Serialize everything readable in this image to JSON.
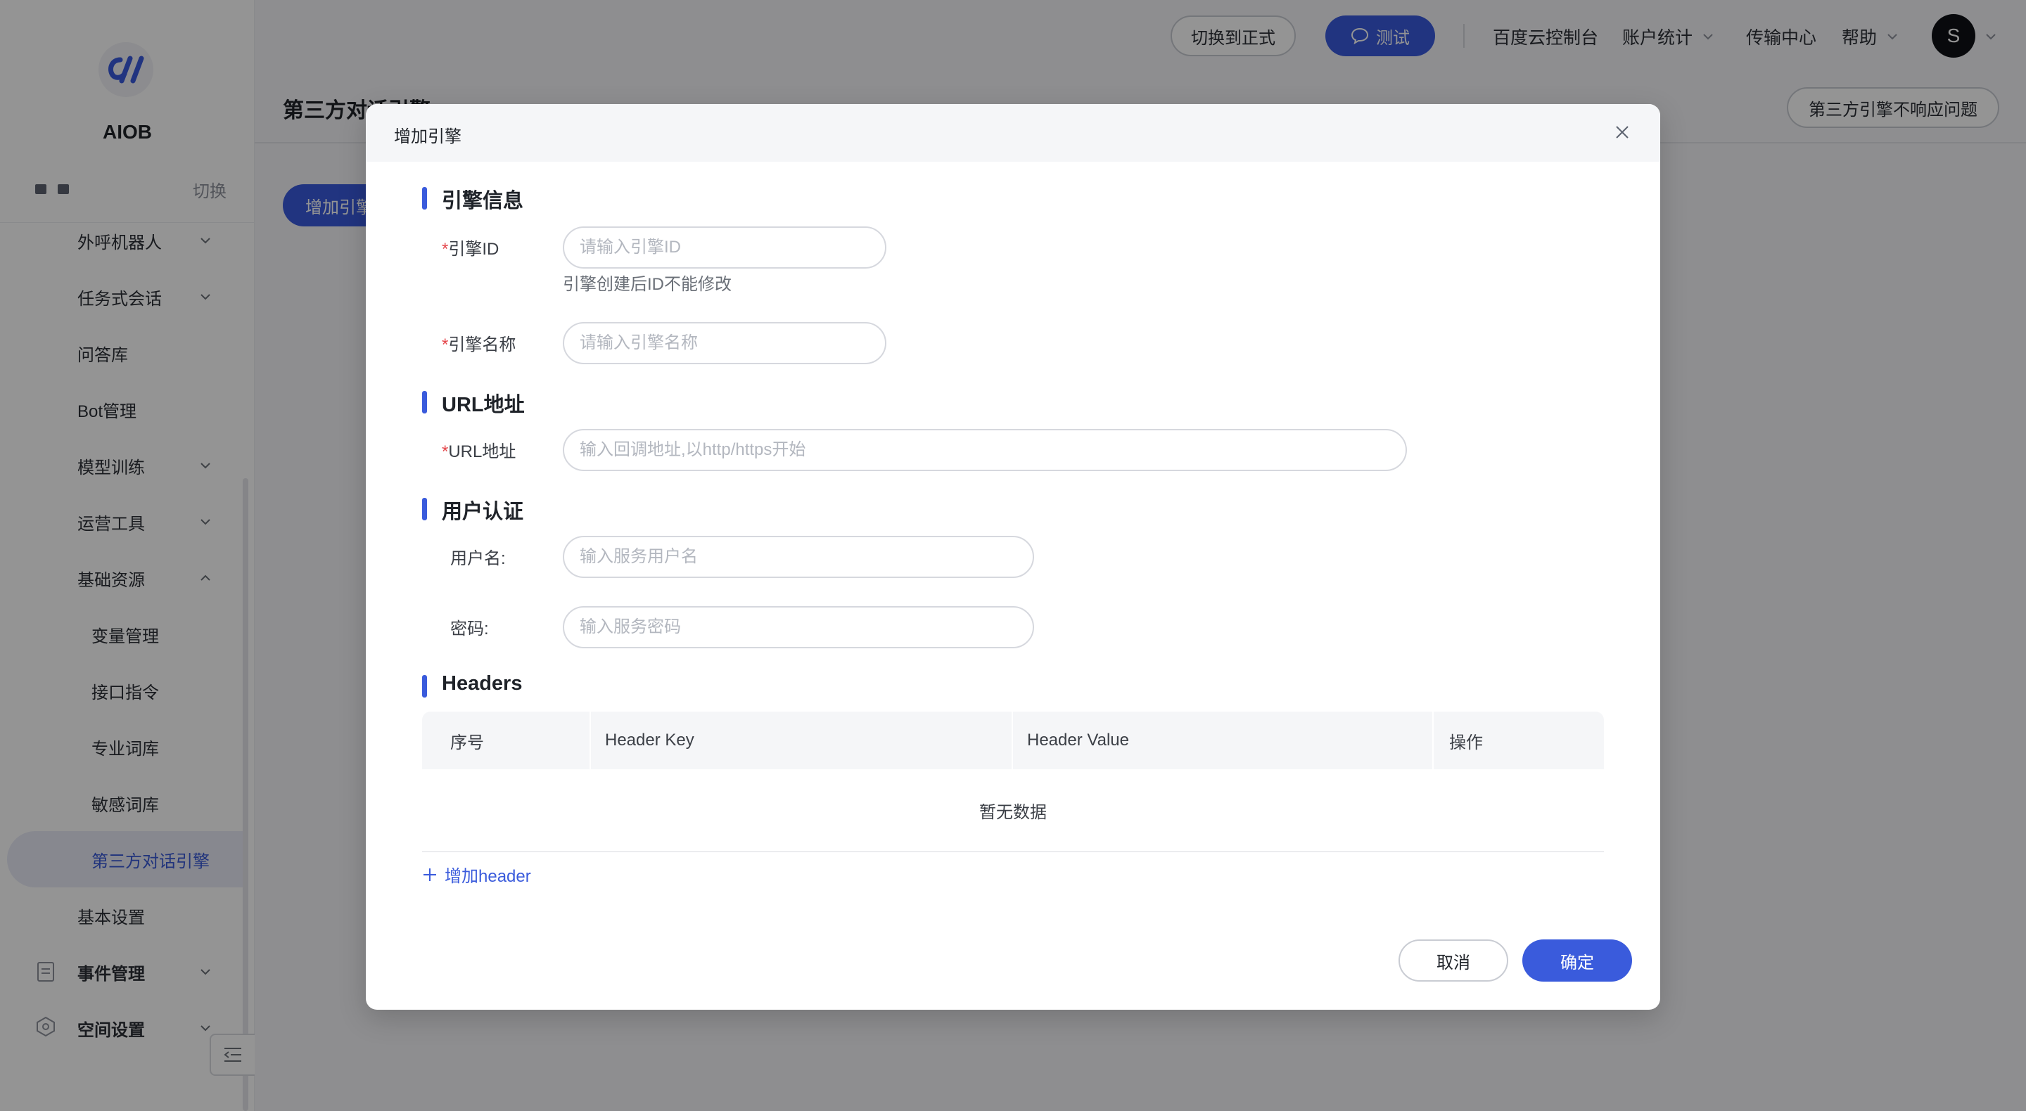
{
  "app": {
    "logo_text": "AIOB",
    "switch_label": "切换"
  },
  "sidebar": {
    "items": [
      {
        "label": "外呼机器人",
        "has_chevron": true,
        "expanded": false
      },
      {
        "label": "任务式会话",
        "has_chevron": true,
        "expanded": false
      },
      {
        "label": "问答库",
        "has_chevron": false
      },
      {
        "label": "Bot管理",
        "has_chevron": false
      },
      {
        "label": "模型训练",
        "has_chevron": true,
        "expanded": false
      },
      {
        "label": "运营工具",
        "has_chevron": true,
        "expanded": false
      },
      {
        "label": "基础资源",
        "has_chevron": true,
        "expanded": true
      },
      {
        "label": "变量管理",
        "sub": true
      },
      {
        "label": "接口指令",
        "sub": true
      },
      {
        "label": "专业词库",
        "sub": true
      },
      {
        "label": "敏感词库",
        "sub": true
      },
      {
        "label": "第三方对话引擎",
        "sub": true,
        "active": true
      },
      {
        "label": "基本设置",
        "has_chevron": false
      },
      {
        "label": "事件管理",
        "has_chevron": true,
        "icon": "document-icon",
        "bold": true
      },
      {
        "label": "空间设置",
        "has_chevron": true,
        "icon": "hexagon-settings-icon",
        "bold": true
      }
    ]
  },
  "topbar": {
    "switch_to_prod": "切换到正式",
    "test_label": "测试",
    "baidu_console": "百度云控制台",
    "account_stats": "账户统计",
    "transfer_center": "传输中心",
    "help": "帮助",
    "avatar_letter": "S"
  },
  "page": {
    "title": "第三方对话引擎",
    "add_engine_button": "增加引擎",
    "problem_button": "第三方引擎不响应问题"
  },
  "modal": {
    "title": "增加引擎",
    "sections": {
      "engine_info": "引擎信息",
      "url": "URL地址",
      "auth": "用户认证",
      "headers": "Headers"
    },
    "fields": {
      "engine_id": {
        "label": "引擎ID",
        "placeholder": "请输入引擎ID",
        "help": "引擎创建后ID不能修改"
      },
      "engine_name": {
        "label": "引擎名称",
        "placeholder": "请输入引擎名称"
      },
      "url": {
        "label": "URL地址",
        "placeholder": "输入回调地址,以http/https开始"
      },
      "username": {
        "label": "用户名:",
        "placeholder": "输入服务用户名"
      },
      "password": {
        "label": "密码:",
        "placeholder": "输入服务密码"
      }
    },
    "headers_table": {
      "columns": [
        "序号",
        "Header Key",
        "Header Value",
        "操作"
      ],
      "empty_text": "暂无数据"
    },
    "add_header": "增加header",
    "cancel": "取消",
    "confirm": "确定"
  },
  "colors": {
    "primary": "#3a5bdc",
    "required": "#e5484d"
  }
}
